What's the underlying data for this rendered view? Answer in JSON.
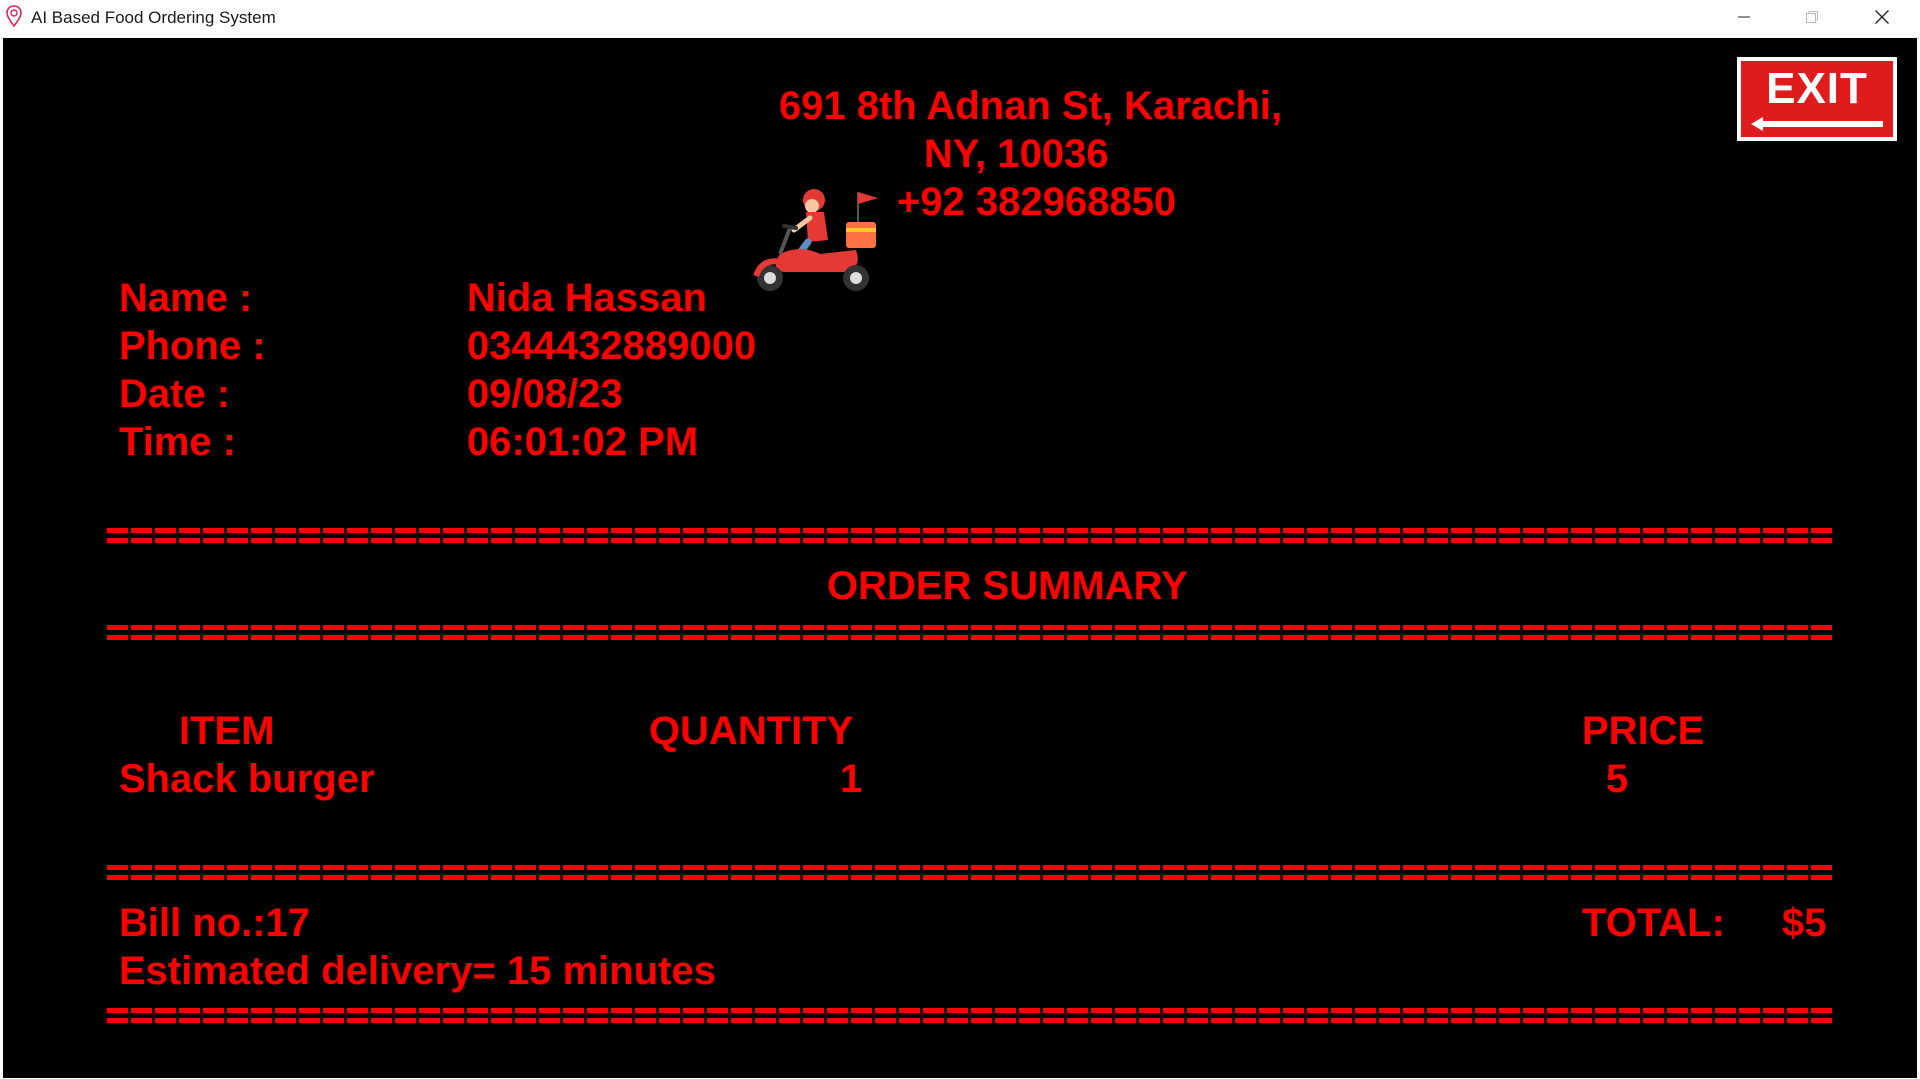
{
  "window": {
    "title": "AI Based Food Ordering System"
  },
  "header": {
    "address_line1": "691 8th Adnan St, Karachi,",
    "address_line2": "NY, 10036",
    "phone": "+92 382968850"
  },
  "exit_button": {
    "label": "EXIT"
  },
  "customer": {
    "name_label": "Name :",
    "name_value": "Nida Hassan",
    "phone_label": "Phone :",
    "phone_value": "0344432889000",
    "date_label": "Date :",
    "date_value": "09/08/23",
    "time_label": "Time :",
    "time_value": "06:01:02 PM"
  },
  "summary": {
    "title": "ORDER SUMMARY",
    "columns": {
      "item": "ITEM",
      "quantity": "QUANTITY",
      "price": "PRICE"
    },
    "rows": [
      {
        "item": "Shack burger",
        "quantity": "1",
        "price": "5"
      }
    ]
  },
  "footer": {
    "bill": "Bill no.:17",
    "total_label": "TOTAL:",
    "total_value": "$5",
    "delivery": "Estimated delivery= 15 minutes"
  },
  "colors": {
    "text": "#ff0000",
    "background": "#000000",
    "exit_button": "#e01b1b"
  },
  "icons": [
    "app-pin-icon",
    "minimize-icon",
    "maximize-icon",
    "close-icon",
    "delivery-scooter-icon",
    "exit-arrow-icon"
  ]
}
